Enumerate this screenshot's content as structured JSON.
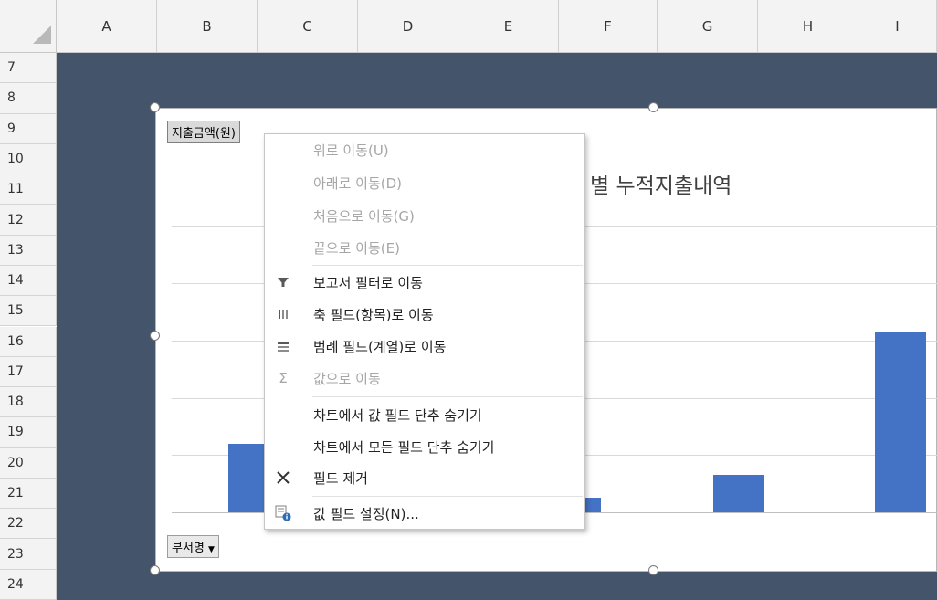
{
  "sheet": {
    "columns": [
      "A",
      "B",
      "C",
      "D",
      "E",
      "F",
      "G",
      "H",
      "I"
    ],
    "rows": [
      "7",
      "8",
      "9",
      "10",
      "11",
      "12",
      "13",
      "14",
      "15",
      "16",
      "17",
      "18",
      "19",
      "20",
      "21",
      "22",
      "23",
      "24"
    ]
  },
  "chart": {
    "title_visible": "별 누적지출내역",
    "value_field_button": "지출금액(원)",
    "axis_field_button": "부서명",
    "axis_field_dropdown": "▼",
    "bar_color": "#4472c4",
    "background_color": "#44546a"
  },
  "chart_data": {
    "type": "bar",
    "title": "별 누적지출내역",
    "categories": [],
    "visible_bar_relative_heights": [
      0.24,
      0.05,
      0.13,
      0.63
    ],
    "grid": true
  },
  "context_menu": {
    "items": [
      {
        "label": "위로 이동(U)",
        "enabled": false,
        "icon": ""
      },
      {
        "label": "아래로 이동(D)",
        "enabled": false,
        "icon": ""
      },
      {
        "label": "처음으로 이동(G)",
        "enabled": false,
        "icon": ""
      },
      {
        "label": "끝으로 이동(E)",
        "enabled": false,
        "icon": ""
      },
      {
        "label": "보고서 필터로 이동",
        "enabled": true,
        "icon": "filter-icon"
      },
      {
        "label": "축 필드(항목)로 이동",
        "enabled": true,
        "icon": "axis-columns-icon"
      },
      {
        "label": "범례 필드(계열)로 이동",
        "enabled": true,
        "icon": "legend-rows-icon"
      },
      {
        "label": "값으로 이동",
        "enabled": false,
        "icon": "sigma-icon"
      },
      {
        "label": "차트에서 값 필드 단추 숨기기",
        "enabled": true,
        "icon": ""
      },
      {
        "label": "차트에서 모든 필드 단추 숨기기",
        "enabled": true,
        "icon": ""
      },
      {
        "label": "필드 제거",
        "enabled": true,
        "icon": "remove-x-icon"
      },
      {
        "label": "값 필드 설정(N)...",
        "enabled": true,
        "icon": "field-settings-icon"
      }
    ]
  }
}
